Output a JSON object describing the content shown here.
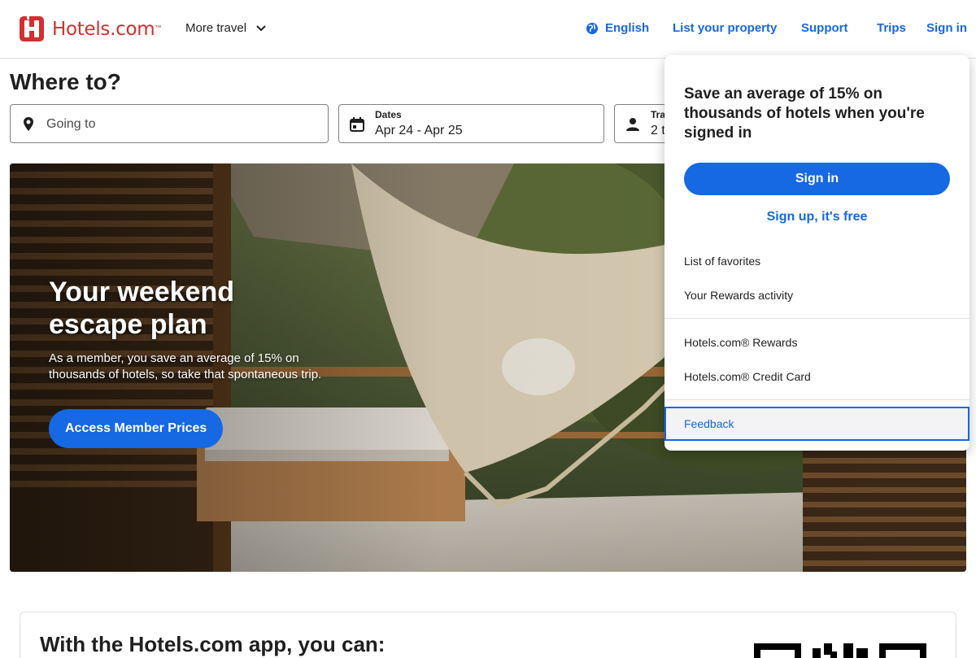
{
  "header": {
    "logo_text": "Hotels.com",
    "logo_tm": "™",
    "more_travel": "More travel",
    "language": "English",
    "list_property": "List your property",
    "support": "Support",
    "trips": "Trips",
    "sign_in": "Sign in"
  },
  "search": {
    "title": "Where to?",
    "going_to_placeholder": "Going to",
    "dates_label": "Dates",
    "dates_value": "Apr 24 - Apr 25",
    "travelers_label": "Tra",
    "travelers_value": "2 t"
  },
  "hero": {
    "title": "Your weekend escape plan",
    "subtitle": "As a member, you save an average of 15% on thousands of hotels, so take that spontaneous trip.",
    "button": "Access Member Prices"
  },
  "app_section": {
    "title": "With the Hotels.com app, you can:"
  },
  "dropdown": {
    "headline": "Save an average of 15% on thousands of hotels when you're signed in",
    "sign_in": "Sign in",
    "sign_up": "Sign up, it's free",
    "items": [
      "List of favorites",
      "Your Rewards activity"
    ],
    "items2": [
      "Hotels.com® Rewards",
      "Hotels.com® Credit Card"
    ],
    "feedback": "Feedback"
  },
  "colors": {
    "brand_red": "#d32f2f",
    "accent_blue": "#1668e3",
    "text": "#1f1f1f",
    "border": "#dfe0e4"
  },
  "icons": {
    "logo": "hotels-logo-icon",
    "chevron": "chevron-down-icon",
    "globe": "globe-icon",
    "location": "location-pin-icon",
    "calendar": "calendar-icon",
    "person": "person-icon"
  }
}
